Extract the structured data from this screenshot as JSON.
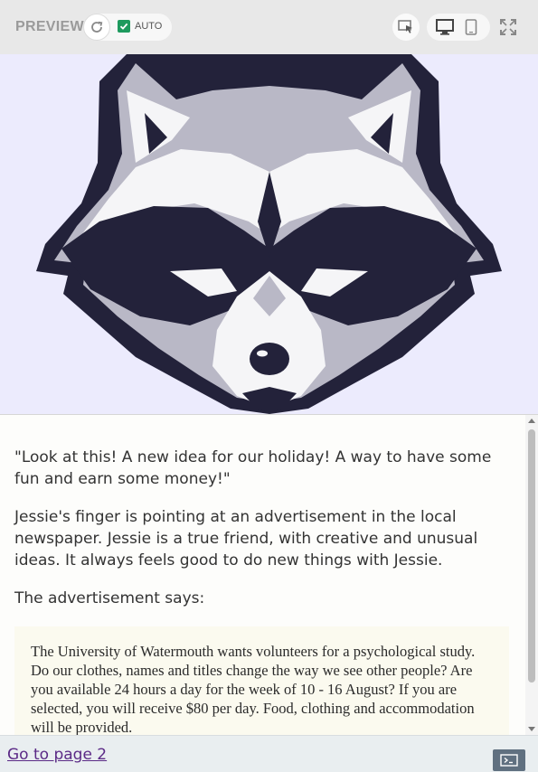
{
  "toolbar": {
    "preview_label": "PREVIEW",
    "auto_label": "AUTO",
    "auto_checked": true,
    "icons": [
      "refresh-icon",
      "checkbox-icon",
      "inspect-icon",
      "desktop-icon",
      "mobile-icon",
      "fullscreen-icon"
    ]
  },
  "hero": {
    "image": "raccoon-face-logo",
    "background": "#ecebfd"
  },
  "content": {
    "paragraphs": [
      "\"Look at this! A new idea for our holiday! A way to have some fun and earn some money!\"",
      "Jessie's finger is pointing at an advertisement in the local newspaper. Jessie is a true friend, with creative and unusual ideas. It always feels good to do new things with Jessie.",
      "The advertisement says:"
    ],
    "advertisement": "The University of Watermouth wants volunteers for a psychological study. Do our clothes, names and titles change the way we see other people? Are you available 24 hours a day for the week of 10 - 16 August? If you are selected, you will receive $80 per day. Food, clothing and accommodation will be provided."
  },
  "footer": {
    "link_label": "Go to page 2",
    "console_icon": "console-icon"
  },
  "colors": {
    "accent_green": "#1e9a5e",
    "link": "#5b2a86",
    "dark": "#23223a",
    "grey": "#b9b8c6"
  }
}
